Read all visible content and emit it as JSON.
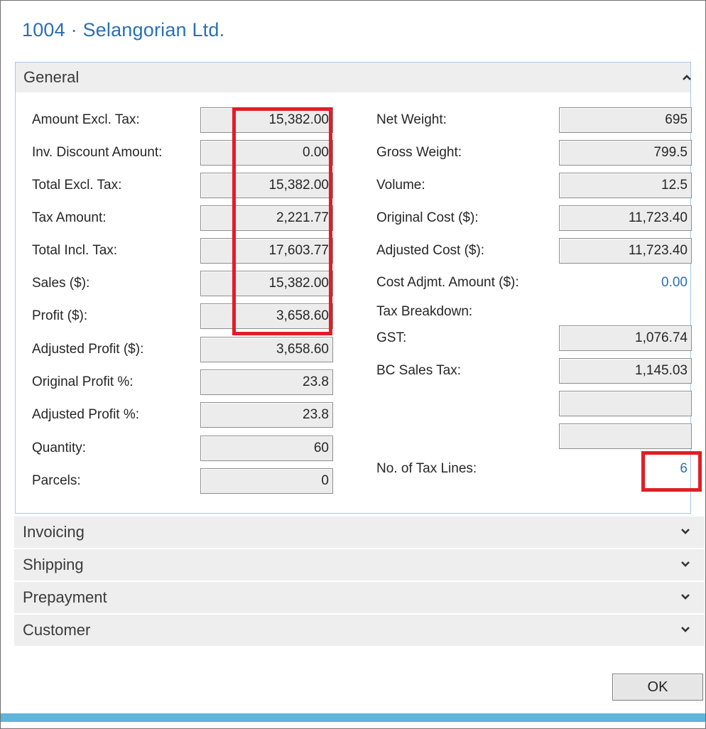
{
  "window": {
    "title": "1004 · Selangorian Ltd."
  },
  "general": {
    "header": "General",
    "left_fields": [
      {
        "label": "Amount Excl. Tax:",
        "value": "15,382.00"
      },
      {
        "label": "Inv. Discount Amount:",
        "value": "0.00"
      },
      {
        "label": "Total Excl. Tax:",
        "value": "15,382.00"
      },
      {
        "label": "Tax Amount:",
        "value": "2,221.77"
      },
      {
        "label": "Total Incl. Tax:",
        "value": "17,603.77"
      },
      {
        "label": "Sales ($):",
        "value": "15,382.00"
      },
      {
        "label": "Profit ($):",
        "value": "3,658.60"
      },
      {
        "label": "Adjusted Profit ($):",
        "value": "3,658.60"
      },
      {
        "label": "Original Profit %:",
        "value": "23.8"
      },
      {
        "label": "Adjusted Profit %:",
        "value": "23.8"
      },
      {
        "label": "Quantity:",
        "value": "60"
      },
      {
        "label": "Parcels:",
        "value": "0"
      }
    ],
    "right_fields": [
      {
        "label": "Net Weight:",
        "value": "695"
      },
      {
        "label": "Gross Weight:",
        "value": "799.5"
      },
      {
        "label": "Volume:",
        "value": "12.5"
      },
      {
        "label": "Original Cost ($):",
        "value": "11,723.40"
      },
      {
        "label": "Adjusted Cost ($):",
        "value": "11,723.40"
      }
    ],
    "cost_adjmt": {
      "label": "Cost Adjmt. Amount ($):",
      "value": "0.00"
    },
    "tax_breakdown_label": "Tax Breakdown:",
    "tax_fields": [
      {
        "label": "GST:",
        "value": "1,076.74"
      },
      {
        "label": "BC Sales Tax:",
        "value": "1,145.03"
      },
      {
        "label": "",
        "value": ""
      },
      {
        "label": "",
        "value": ""
      }
    ],
    "tax_lines": {
      "label": "No. of Tax Lines:",
      "value": "6"
    }
  },
  "collapsed_tabs": [
    {
      "label": "Invoicing"
    },
    {
      "label": "Shipping"
    },
    {
      "label": "Prepayment"
    },
    {
      "label": "Customer"
    }
  ],
  "footer": {
    "ok_label": "OK"
  },
  "colors": {
    "title": "#2a6fb5",
    "link": "#2a6fb5",
    "highlight": "#e01e26",
    "bottom_bar": "#5fb5dc"
  },
  "icons": {
    "expanded": "chevron-up-icon",
    "collapsed": "chevron-down-icon"
  }
}
